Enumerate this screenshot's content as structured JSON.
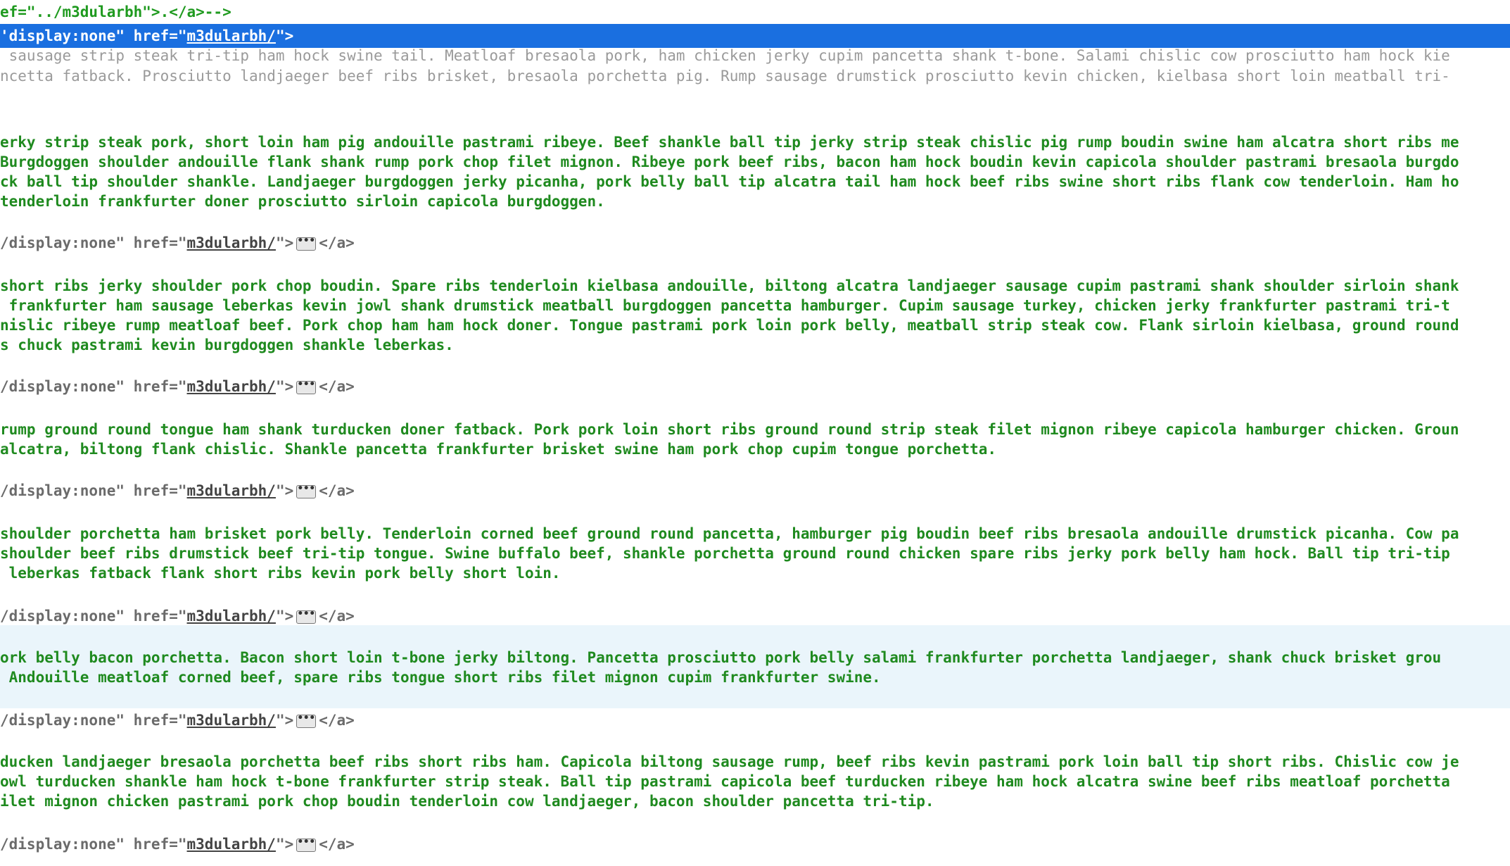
{
  "top_comment": "ef=\"../m3dularbh\">.</a>-->",
  "selected": {
    "prefix": "'display:none\" href=\"",
    "href": "m3dularbh/",
    "suffix": "\">"
  },
  "gray_lines": [
    " sausage strip steak tri-tip ham hock swine tail. Meatloaf bresaola pork, ham chicken jerky cupim pancetta shank t-bone. Salami chislic cow prosciutto ham hock kie",
    "ncetta fatback. Prosciutto landjaeger beef ribs brisket, bresaola porchetta pig. Rump sausage drumstick prosciutto kevin chicken, kielbasa short loin meatball tri-"
  ],
  "tag": {
    "prefix": "/display:none\" href=\"",
    "href": "m3dularbh/",
    "mid": "\">",
    "ellipsis": "•••",
    "close": "</a>"
  },
  "blocks": [
    [
      "erky strip steak pork, short loin ham pig andouille pastrami ribeye. Beef shankle ball tip jerky strip steak chislic pig rump boudin swine ham alcatra short ribs me",
      "Burgdoggen shoulder andouille flank shank rump pork chop filet mignon. Ribeye pork beef ribs, bacon ham hock boudin kevin capicola shoulder pastrami bresaola burgdo",
      "ck ball tip shoulder shankle. Landjaeger burgdoggen jerky picanha, pork belly ball tip alcatra tail ham hock beef ribs swine short ribs flank cow tenderloin. Ham ho",
      "tenderloin frankfurter doner prosciutto sirloin capicola burgdoggen."
    ],
    [
      "short ribs jerky shoulder pork chop boudin. Spare ribs tenderloin kielbasa andouille, biltong alcatra landjaeger sausage cupim pastrami shank shoulder sirloin shank",
      " frankfurter ham sausage leberkas kevin jowl shank drumstick meatball burgdoggen pancetta hamburger. Cupim sausage turkey, chicken jerky frankfurter pastrami tri-t",
      "nislic ribeye rump meatloaf beef. Pork chop ham ham hock doner. Tongue pastrami pork loin pork belly, meatball strip steak cow. Flank sirloin kielbasa, ground round",
      "s chuck pastrami kevin burgdoggen shankle leberkas."
    ],
    [
      "rump ground round tongue ham shank turducken doner fatback. Pork pork loin short ribs ground round strip steak filet mignon ribeye capicola hamburger chicken. Groun",
      "alcatra, biltong flank chislic. Shankle pancetta frankfurter brisket swine ham pork chop cupim tongue porchetta."
    ],
    [
      "shoulder porchetta ham brisket pork belly. Tenderloin corned beef ground round pancetta, hamburger pig boudin beef ribs bresaola andouille drumstick picanha. Cow pa",
      "shoulder beef ribs drumstick beef tri-tip tongue. Swine buffalo beef, shankle porchetta ground round chicken spare ribs jerky pork belly ham hock. Ball tip tri-tip",
      " leberkas fatback flank short ribs kevin pork belly short loin."
    ],
    [
      "ork belly bacon porchetta. Bacon short loin t-bone jerky biltong. Pancetta prosciutto pork belly salami frankfurter porchetta landjaeger, shank chuck brisket grou",
      " Andouille meatloaf corned beef, spare ribs tongue short ribs filet mignon cupim frankfurter swine."
    ],
    [
      "ducken landjaeger bresaola porchetta beef ribs short ribs ham. Capicola biltong sausage rump, beef ribs kevin pastrami pork loin ball tip short ribs. Chislic cow je",
      "owl turducken shankle ham hock t-bone frankfurter strip steak. Ball tip pastrami capicola beef turducken ribeye ham hock alcatra swine beef ribs meatloaf porchetta",
      "ilet mignon chicken pastrami pork chop boudin tenderloin cow landjaeger, bacon shoulder pancetta tri-tip."
    ]
  ]
}
